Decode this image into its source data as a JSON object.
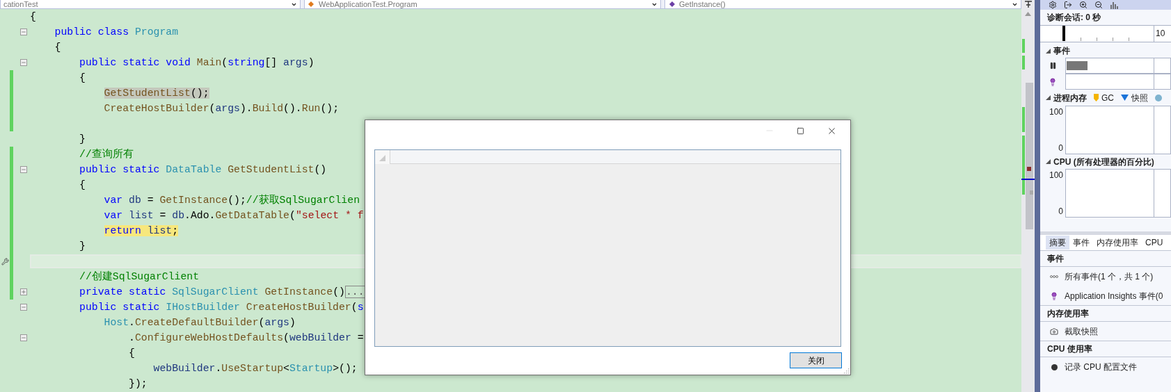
{
  "top_bar": {
    "dropdowns": [
      {
        "kind": "project",
        "text": "cationTest"
      },
      {
        "kind": "class",
        "text": "WebApplicationTest.Program"
      },
      {
        "kind": "member",
        "text": "GetInstance()"
      }
    ]
  },
  "editor": {
    "lines": [
      {
        "tokens": [
          {
            "kind": "plain",
            "text": "{"
          }
        ],
        "changed": false,
        "current": false
      },
      {
        "tokens": [
          {
            "kind": "keyword",
            "text": "    public class "
          },
          {
            "kind": "type",
            "text": "Program"
          }
        ],
        "changed": false,
        "current": false,
        "foldable": true,
        "expanded": true
      },
      {
        "tokens": [
          {
            "kind": "plain",
            "text": "    {"
          }
        ],
        "changed": false,
        "current": false
      },
      {
        "tokens": [
          {
            "kind": "keyword",
            "text": "        public static void "
          },
          {
            "kind": "method",
            "text": "Main"
          },
          {
            "kind": "plain",
            "text": "("
          },
          {
            "kind": "keyword",
            "text": "string"
          },
          {
            "kind": "plain",
            "text": "[] "
          },
          {
            "kind": "param",
            "text": "args"
          },
          {
            "kind": "plain",
            "text": ")"
          }
        ],
        "changed": false,
        "current": false,
        "foldable": true,
        "expanded": true
      },
      {
        "tokens": [
          {
            "kind": "plain",
            "text": "        {"
          }
        ],
        "changed": true,
        "current": false
      },
      {
        "tokens": [
          {
            "kind": "method",
            "text": "            GetStudentList",
            "referenced": true
          },
          {
            "kind": "plain",
            "text": "();",
            "referenced": true
          }
        ],
        "changed": true,
        "current": false
      },
      {
        "tokens": [
          {
            "kind": "method",
            "text": "            CreateHostBuilder"
          },
          {
            "kind": "plain",
            "text": "("
          },
          {
            "kind": "param",
            "text": "args"
          },
          {
            "kind": "plain",
            "text": ")."
          },
          {
            "kind": "method",
            "text": "Build"
          },
          {
            "kind": "plain",
            "text": "()."
          },
          {
            "kind": "method",
            "text": "Run"
          },
          {
            "kind": "plain",
            "text": "();"
          }
        ],
        "changed": true,
        "current": false
      },
      {
        "changed": true,
        "current": false
      },
      {
        "tokens": [
          {
            "kind": "plain",
            "text": "        }"
          }
        ],
        "changed": false,
        "current": false
      },
      {
        "tokens": [
          {
            "kind": "comment",
            "text": "        //查询所有"
          }
        ],
        "changed": true,
        "current": false
      },
      {
        "tokens": [
          {
            "kind": "keyword",
            "text": "        public static "
          },
          {
            "kind": "type",
            "text": "DataTable "
          },
          {
            "kind": "method",
            "text": "GetStudentList"
          },
          {
            "kind": "plain",
            "text": "()"
          }
        ],
        "changed": true,
        "current": false,
        "foldable": true,
        "expanded": true
      },
      {
        "tokens": [
          {
            "kind": "plain",
            "text": "        {"
          }
        ],
        "changed": true,
        "current": false
      },
      {
        "tokens": [
          {
            "kind": "keyword",
            "text": "            var "
          },
          {
            "kind": "param",
            "text": "db"
          },
          {
            "kind": "plain",
            "text": " = "
          },
          {
            "kind": "method",
            "text": "GetInstance"
          },
          {
            "kind": "plain",
            "text": "();"
          },
          {
            "kind": "comment",
            "text": "//获取SqlSugarClien"
          }
        ],
        "changed": true,
        "current": false
      },
      {
        "tokens": [
          {
            "kind": "keyword",
            "text": "            var "
          },
          {
            "kind": "param",
            "text": "list"
          },
          {
            "kind": "plain",
            "text": " = "
          },
          {
            "kind": "param",
            "text": "db"
          },
          {
            "kind": "plain",
            "text": ".Ado."
          },
          {
            "kind": "method",
            "text": "GetDataTable"
          },
          {
            "kind": "plain",
            "text": "("
          },
          {
            "kind": "string",
            "text": "\"select * f"
          }
        ],
        "changed": true,
        "current": false
      },
      {
        "tokens": [
          {
            "kind": "keyword",
            "text": "            return ",
            "executing": true
          },
          {
            "kind": "param",
            "text": "list",
            "executing": true
          },
          {
            "kind": "plain",
            "text": ";",
            "executing": true
          }
        ],
        "changed": true,
        "current": false
      },
      {
        "tokens": [
          {
            "kind": "plain",
            "text": "        }"
          }
        ],
        "changed": true,
        "current": false
      },
      {
        "changed": true,
        "current": true,
        "quick_action": true
      },
      {
        "tokens": [
          {
            "kind": "comment",
            "text": "        //创建SqlSugarClient"
          }
        ],
        "changed": true,
        "current": false
      },
      {
        "tokens": [
          {
            "kind": "keyword",
            "text": "        private static "
          },
          {
            "kind": "type",
            "text": "SqlSugarClient "
          },
          {
            "kind": "method",
            "text": "GetInstance"
          },
          {
            "kind": "plain",
            "text": "()"
          },
          {
            "kind": "collapsed",
            "text": "..."
          }
        ],
        "changed": true,
        "current": false,
        "foldable": true,
        "expanded": false
      },
      {
        "tokens": [
          {
            "kind": "keyword",
            "text": "        public static "
          },
          {
            "kind": "type",
            "text": "IHostBuilder "
          },
          {
            "kind": "method",
            "text": "CreateHostBuilder"
          },
          {
            "kind": "plain",
            "text": "("
          },
          {
            "kind": "keyword",
            "text": "s"
          }
        ],
        "changed": false,
        "current": false,
        "foldable": true,
        "expanded": true
      },
      {
        "tokens": [
          {
            "kind": "type",
            "text": "            Host"
          },
          {
            "kind": "plain",
            "text": "."
          },
          {
            "kind": "method",
            "text": "CreateDefaultBuilder"
          },
          {
            "kind": "plain",
            "text": "("
          },
          {
            "kind": "param",
            "text": "args"
          },
          {
            "kind": "plain",
            "text": ")"
          }
        ],
        "changed": false,
        "current": false
      },
      {
        "tokens": [
          {
            "kind": "plain",
            "text": "                ."
          },
          {
            "kind": "method",
            "text": "ConfigureWebHostDefaults"
          },
          {
            "kind": "plain",
            "text": "("
          },
          {
            "kind": "param",
            "text": "webBuilder"
          },
          {
            "kind": "plain",
            "text": " ="
          }
        ],
        "changed": false,
        "current": false,
        "foldable": true,
        "expanded": true
      },
      {
        "tokens": [
          {
            "kind": "plain",
            "text": "                {"
          }
        ],
        "changed": false,
        "current": false
      },
      {
        "tokens": [
          {
            "kind": "param",
            "text": "                    webBuilder"
          },
          {
            "kind": "plain",
            "text": "."
          },
          {
            "kind": "method",
            "text": "UseStartup"
          },
          {
            "kind": "plain",
            "text": "<"
          },
          {
            "kind": "type",
            "text": "Startup"
          },
          {
            "kind": "plain",
            "text": ">();"
          }
        ],
        "changed": false,
        "current": false
      },
      {
        "tokens": [
          {
            "kind": "plain",
            "text": "                });"
          }
        ],
        "changed": false,
        "current": false
      }
    ]
  },
  "diagnostics": {
    "session_label": "诊断会话: 0 秒",
    "timeline_label": "10",
    "events": {
      "title": "事件",
      "rows": [
        {
          "kind": "pause"
        },
        {
          "kind": "insights"
        }
      ]
    },
    "memory": {
      "title": "进程内存",
      "legend": [
        {
          "kind": "gc",
          "label": "GC"
        },
        {
          "kind": "snapshot",
          "label": "快照"
        },
        {
          "kind": "dot"
        }
      ],
      "axis": [
        "100",
        "0"
      ]
    },
    "cpu": {
      "title": "CPU (所有处理器的百分比)",
      "axis": [
        "100",
        "0"
      ]
    },
    "tabs": [
      {
        "label": "摘要",
        "selected": true
      },
      {
        "label": "事件",
        "selected": false
      },
      {
        "label": "内存使用率",
        "selected": false
      },
      {
        "label": "CPU",
        "selected": false
      }
    ],
    "sections": [
      {
        "title": "事件",
        "items": [
          {
            "kind": "events",
            "text": "所有事件(1 个，共 1 个)"
          },
          {
            "kind": "insights",
            "text": "Application Insights 事件(0"
          }
        ]
      },
      {
        "title": "内存使用率",
        "items": [
          {
            "kind": "snapshot",
            "text": "截取快照"
          }
        ]
      },
      {
        "title": "CPU 使用率",
        "items": [
          {
            "kind": "record",
            "text": "记录 CPU 配置文件"
          }
        ]
      }
    ]
  },
  "dialog": {
    "controls": [
      {
        "kind": "minimize",
        "disabled": true
      },
      {
        "kind": "maximize",
        "disabled": false
      },
      {
        "kind": "close",
        "disabled": false
      }
    ],
    "button": "关闭"
  }
}
